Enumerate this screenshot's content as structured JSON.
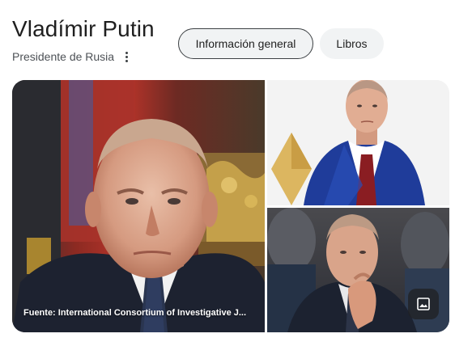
{
  "entity": {
    "name": "Vladímir Putin",
    "description": "Presidente de Rusia"
  },
  "chips": [
    {
      "label": "Información general",
      "selected": true
    },
    {
      "label": "Libros",
      "selected": false
    }
  ],
  "gallery": {
    "source_caption": "Fuente: International Consortium of Investigative J...",
    "images": [
      {
        "subject": "portrait-close-up",
        "background": "red-flag-and-gold-interior"
      },
      {
        "subject": "portrait-blue-suit",
        "background": "white-with-gold-diamond"
      },
      {
        "subject": "portrait-hand-on-chin",
        "background": "audience-blurred"
      }
    ],
    "more_images_icon": "image-icon"
  },
  "colors": {
    "title": "#1f1f1f",
    "subtitle": "#4d5156",
    "chip_bg": "#f1f3f4",
    "chip_selected_border": "#3c4043"
  }
}
